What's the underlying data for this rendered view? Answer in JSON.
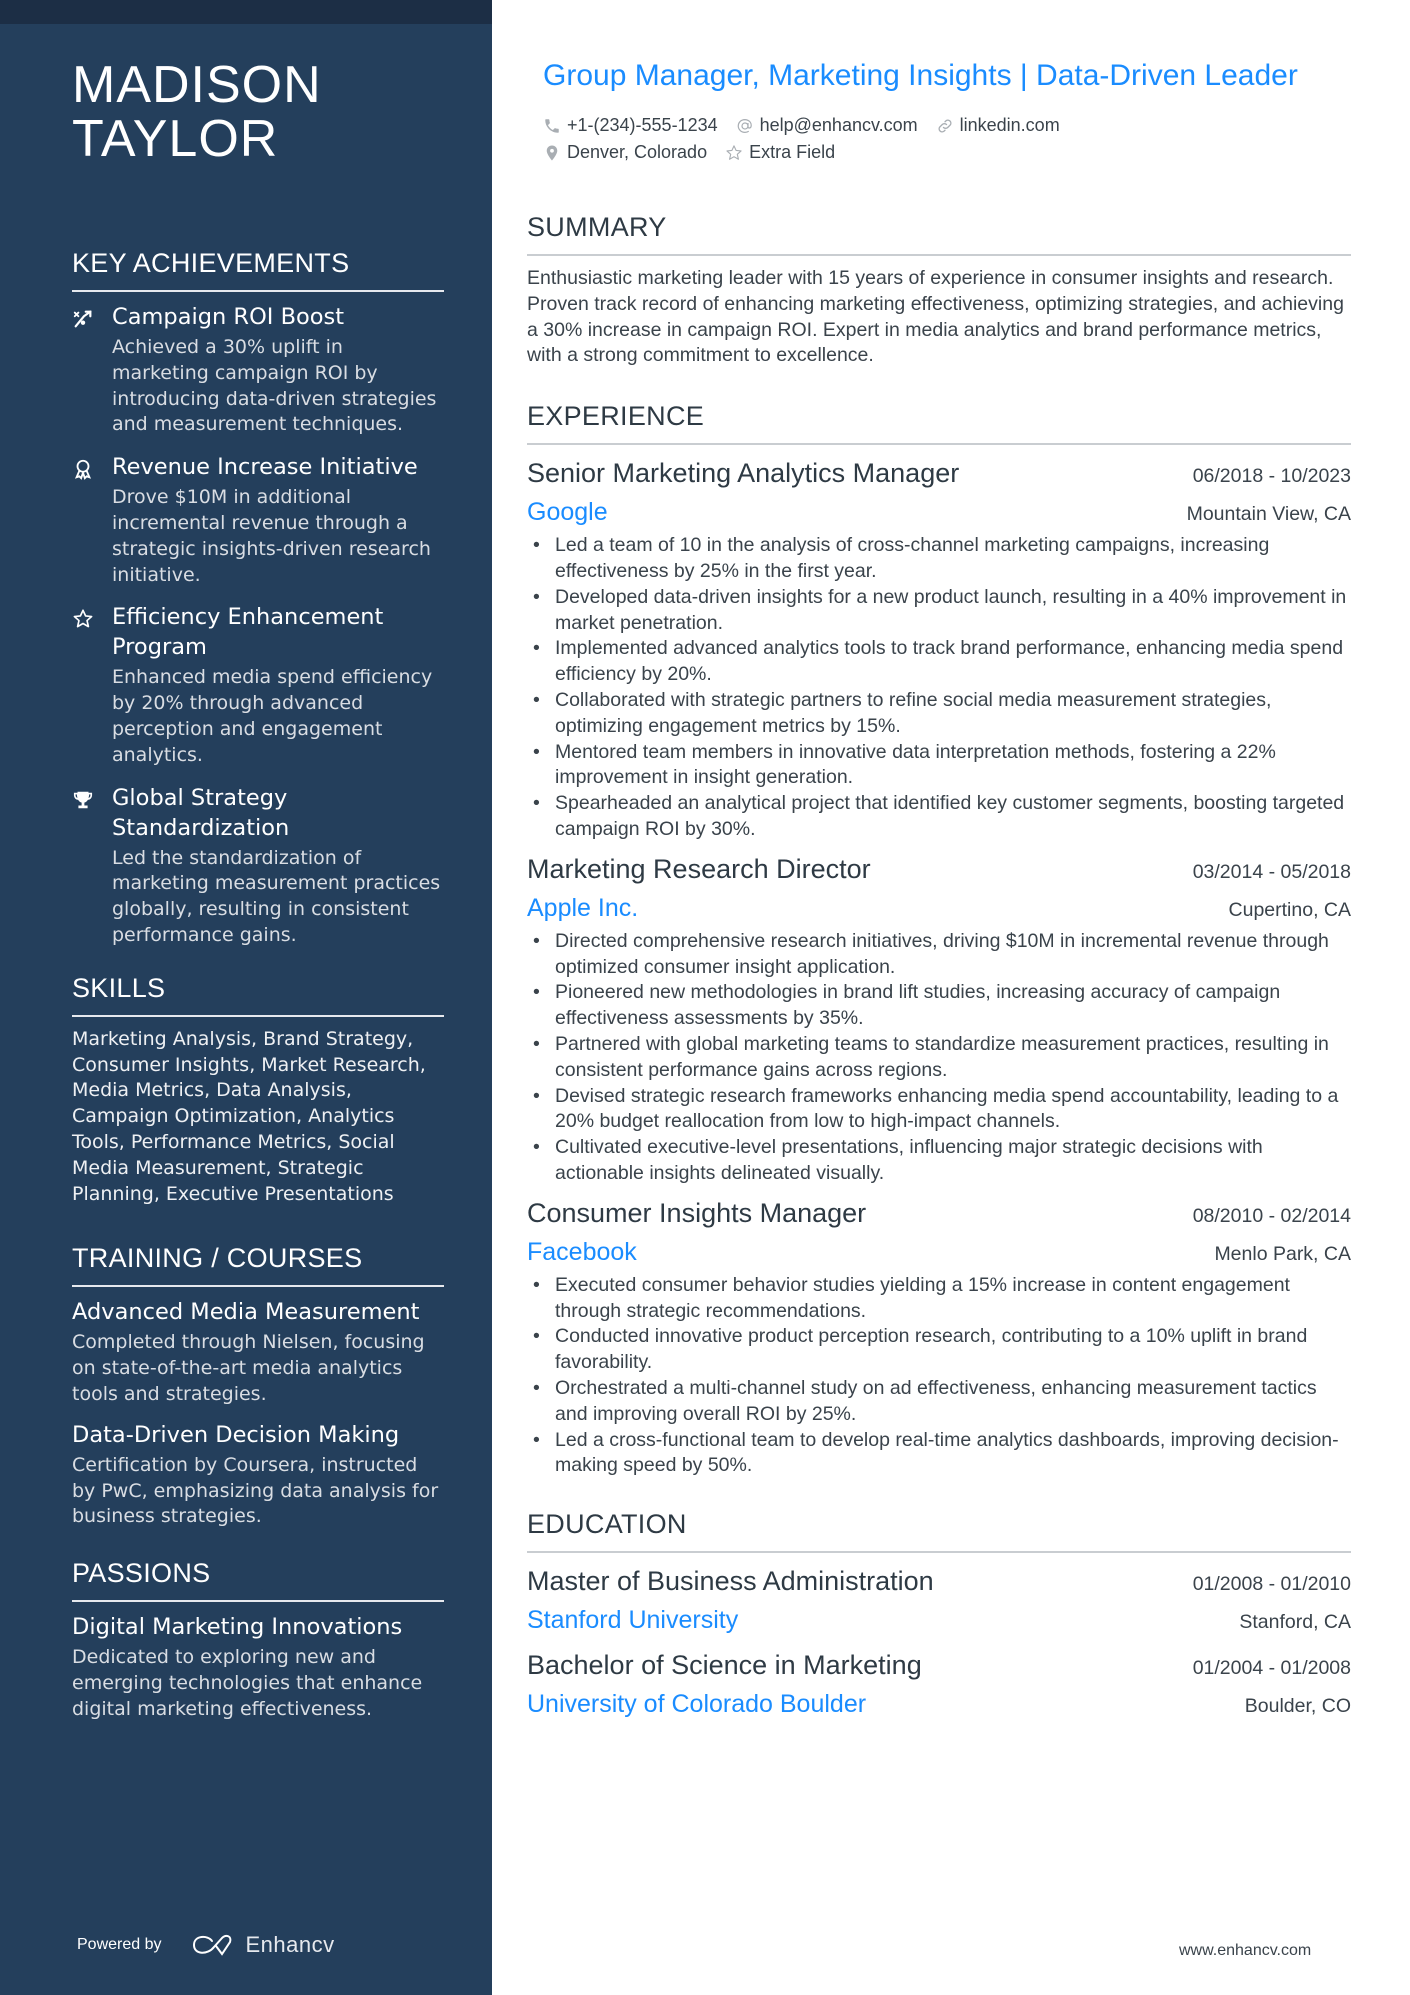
{
  "sidebar": {
    "name_line1": "MADISON",
    "name_line2": "TAYLOR",
    "achievements": {
      "heading": "KEY ACHIEVEMENTS",
      "items": [
        {
          "icon": "chart-line-icon",
          "title": "Campaign ROI Boost",
          "desc": "Achieved a 30% uplift in marketing campaign ROI by introducing data-driven strategies and measurement techniques."
        },
        {
          "icon": "award-ribbon-icon",
          "title": "Revenue Increase Initiative",
          "desc": "Drove $10M in additional incremental revenue through a strategic insights-driven research initiative."
        },
        {
          "icon": "star-icon",
          "title": "Efficiency Enhancement Program",
          "desc": "Enhanced media spend efficiency by 20% through advanced perception and engagement analytics."
        },
        {
          "icon": "trophy-icon",
          "title": "Global Strategy Standardization",
          "desc": "Led the standardization of marketing measurement practices globally, resulting in consistent performance gains."
        }
      ]
    },
    "skills": {
      "heading": "SKILLS",
      "text": "Marketing Analysis, Brand Strategy, Consumer Insights, Market Research, Media Metrics, Data Analysis, Campaign Optimization, Analytics Tools, Performance Metrics, Social Media Measurement, Strategic Planning, Executive Presentations"
    },
    "training": {
      "heading": "TRAINING / COURSES",
      "items": [
        {
          "title": "Advanced Media Measurement",
          "desc": "Completed through Nielsen, focusing on state-of-the-art media analytics tools and strategies."
        },
        {
          "title": "Data-Driven Decision Making",
          "desc": "Certification by Coursera, instructed by PwC, emphasizing data analysis for business strategies."
        }
      ]
    },
    "passions": {
      "heading": "PASSIONS",
      "items": [
        {
          "title": "Digital Marketing Innovations",
          "desc": "Dedicated to exploring new and emerging technologies that enhance digital marketing effectiveness."
        }
      ]
    },
    "powered_by": "Powered by",
    "brand": "Enhancv"
  },
  "main": {
    "title": "Group Manager, Marketing Insights | Data-Driven Leader",
    "contact": {
      "phone": "+1-(234)-555-1234",
      "email": "help@enhancv.com",
      "link": "linkedin.com",
      "location": "Denver, Colorado",
      "extra": "Extra Field"
    },
    "summary": {
      "heading": "SUMMARY",
      "text": "Enthusiastic marketing leader with 15 years of experience in consumer insights and research. Proven track record of enhancing marketing effectiveness, optimizing strategies, and achieving a 30% increase in campaign ROI. Expert in media analytics and brand performance metrics, with a strong commitment to excellence."
    },
    "experience": {
      "heading": "EXPERIENCE",
      "jobs": [
        {
          "title": "Senior Marketing Analytics Manager",
          "dates": "06/2018 - 10/2023",
          "company": "Google",
          "location": "Mountain View, CA",
          "bullets": [
            "Led a team of 10 in the analysis of cross-channel marketing campaigns, increasing effectiveness by 25% in the first year.",
            "Developed data-driven insights for a new product launch, resulting in a 40% improvement in market penetration.",
            "Implemented advanced analytics tools to track brand performance, enhancing media spend efficiency by 20%.",
            "Collaborated with strategic partners to refine social media measurement strategies, optimizing engagement metrics by 15%.",
            "Mentored team members in innovative data interpretation methods, fostering a 22% improvement in insight generation.",
            "Spearheaded an analytical project that identified key customer segments, boosting targeted campaign ROI by 30%."
          ]
        },
        {
          "title": "Marketing Research Director",
          "dates": "03/2014 - 05/2018",
          "company": "Apple Inc.",
          "location": "Cupertino, CA",
          "bullets": [
            "Directed comprehensive research initiatives, driving $10M in incremental revenue through optimized consumer insight application.",
            "Pioneered new methodologies in brand lift studies, increasing accuracy of campaign effectiveness assessments by 35%.",
            "Partnered with global marketing teams to standardize measurement practices, resulting in consistent performance gains across regions.",
            "Devised strategic research frameworks enhancing media spend accountability, leading to a 20% budget reallocation from low to high-impact channels.",
            "Cultivated executive-level presentations, influencing major strategic decisions with actionable insights delineated visually."
          ]
        },
        {
          "title": "Consumer Insights Manager",
          "dates": "08/2010 - 02/2014",
          "company": "Facebook",
          "location": "Menlo Park, CA",
          "bullets": [
            "Executed consumer behavior studies yielding a 15% increase in content engagement through strategic recommendations.",
            "Conducted innovative product perception research, contributing to a 10% uplift in brand favorability.",
            "Orchestrated a multi-channel study on ad effectiveness, enhancing measurement tactics and improving overall ROI by 25%.",
            "Led a cross-functional team to develop real-time analytics dashboards, improving decision-making speed by 50%."
          ]
        }
      ]
    },
    "education": {
      "heading": "EDUCATION",
      "items": [
        {
          "degree": "Master of Business Administration",
          "dates": "01/2008 - 01/2010",
          "school": "Stanford University",
          "location": "Stanford, CA"
        },
        {
          "degree": "Bachelor of Science in Marketing",
          "dates": "01/2004 - 01/2008",
          "school": "University of Colorado Boulder",
          "location": "Boulder, CO"
        }
      ]
    },
    "footer_url": "www.enhancv.com"
  },
  "colors": {
    "sidebar_bg": "#243f5c",
    "sidebar_band": "#1c2e45",
    "accent": "#1a8cff",
    "text": "#2e3a44"
  }
}
